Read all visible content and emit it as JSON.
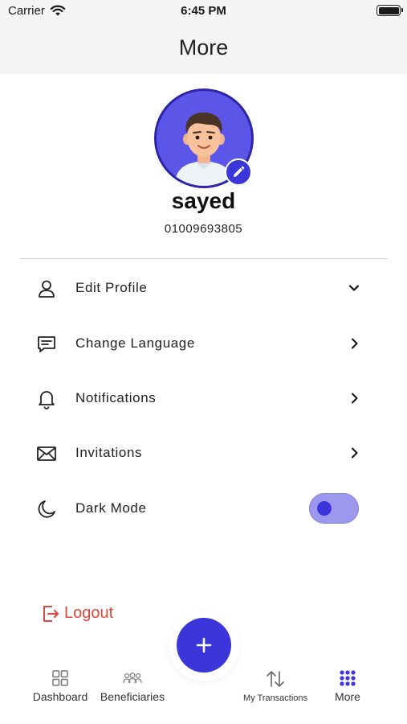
{
  "status_bar": {
    "carrier": "Carrier",
    "time": "6:45 PM"
  },
  "header": {
    "title": "More"
  },
  "profile": {
    "name": "sayed",
    "phone": "01009693805"
  },
  "menu": [
    {
      "label": "Edit Profile",
      "icon": "user-icon",
      "trailing": "chevron-down-icon"
    },
    {
      "label": "Change Language",
      "icon": "chat-icon",
      "trailing": "chevron-right-icon"
    },
    {
      "label": "Notifications",
      "icon": "bell-icon",
      "trailing": "chevron-right-icon"
    },
    {
      "label": "Invitations",
      "icon": "envelope-icon",
      "trailing": "chevron-right-icon"
    },
    {
      "label": "Dark Mode",
      "icon": "moon-icon",
      "trailing": "toggle",
      "toggle_on": true
    }
  ],
  "logout": {
    "label": "Logout",
    "color": "#e0443a"
  },
  "fab": {
    "icon": "plus-icon"
  },
  "tabs": [
    {
      "label": "Dashboard",
      "icon": "grid-icon"
    },
    {
      "label": "Beneficiaries",
      "icon": "people-icon"
    },
    {
      "label": "My Transactions",
      "icon": "transfer-arrows-icon"
    },
    {
      "label": "More",
      "icon": "dots-grid-icon",
      "active": true
    }
  ],
  "colors": {
    "accent": "#3b36d9",
    "avatar_bg": "#5b55e8",
    "toggle_track": "#9b98ee",
    "danger": "#e0443a"
  }
}
